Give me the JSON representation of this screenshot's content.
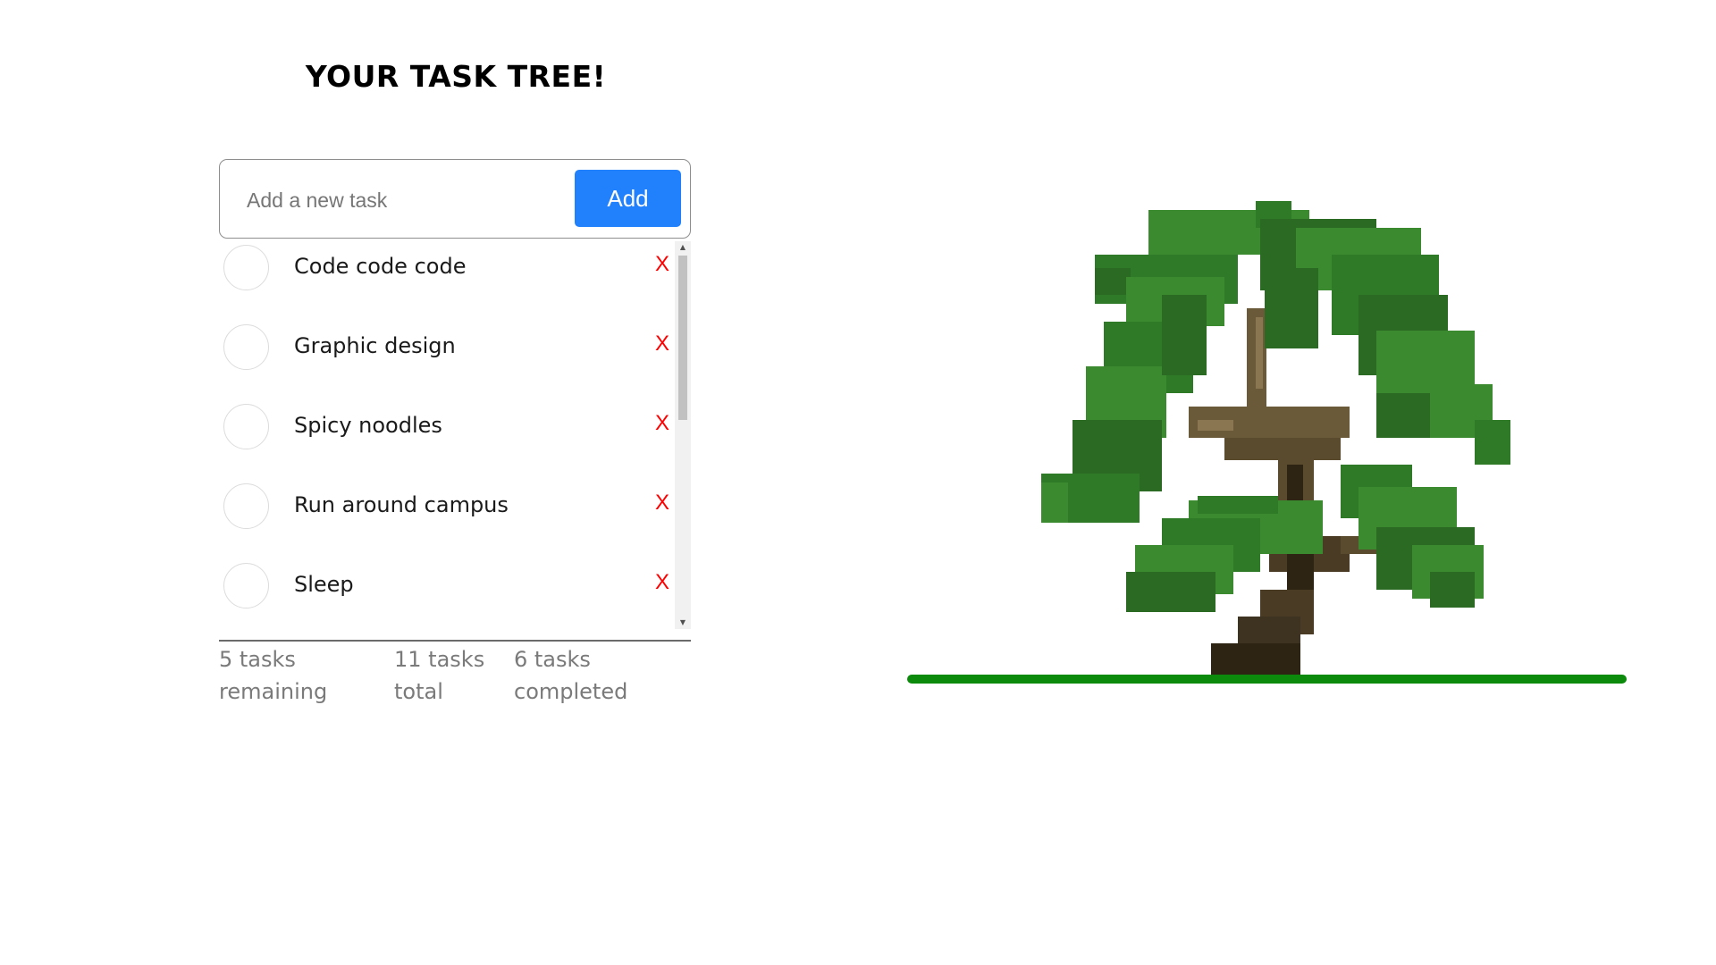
{
  "page": {
    "title": "YOUR TASK TREE!"
  },
  "new_task": {
    "placeholder": "Add a new task",
    "value": "",
    "add_label": "Add"
  },
  "tasks": [
    {
      "label": "Code code code",
      "delete_label": "X",
      "completed": false
    },
    {
      "label": "Graphic design",
      "delete_label": "X",
      "completed": false
    },
    {
      "label": "Spicy noodles",
      "delete_label": "X",
      "completed": false
    },
    {
      "label": "Run around campus",
      "delete_label": "X",
      "completed": false
    },
    {
      "label": "Sleep",
      "delete_label": "X",
      "completed": false
    }
  ],
  "stats": {
    "remaining": "5 tasks\nremaining",
    "total": "11 tasks\ntotal",
    "completed": "6 tasks\ncompleted"
  },
  "colors": {
    "accent": "#2180fb",
    "delete": "#ff0000",
    "ground": "#0c8a0c",
    "leaf_dark": "#2b6a22",
    "leaf_light": "#3c8a30",
    "trunk": "#6b5a3a",
    "trunk_dark": "#2e2414"
  }
}
